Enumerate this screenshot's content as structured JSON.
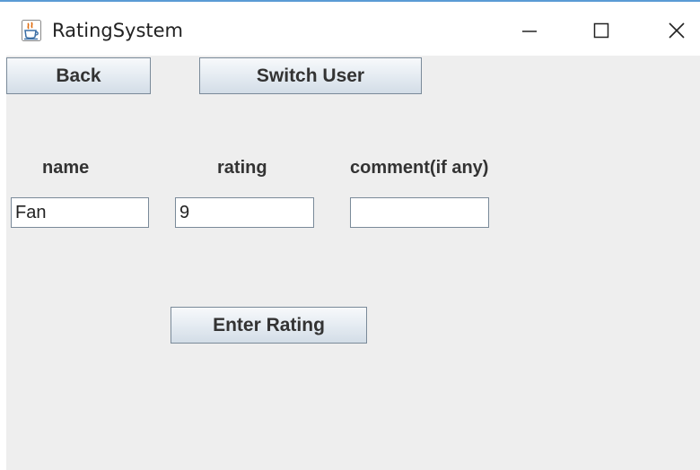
{
  "window": {
    "title": "RatingSystem"
  },
  "toolbar": {
    "back_label": "Back",
    "switch_user_label": "Switch User"
  },
  "form": {
    "name_label": "name",
    "rating_label": "rating",
    "comment_label": "comment(if any)",
    "name_value": "Fan",
    "rating_value": "9",
    "comment_value": ""
  },
  "actions": {
    "enter_rating_label": "Enter Rating"
  },
  "colors": {
    "accent": "#5a9bd5",
    "panel_background": "#eeeeee"
  },
  "icons": {
    "app": "java-cup-icon",
    "minimize": "minimize-icon",
    "maximize": "maximize-icon",
    "close": "close-icon"
  }
}
